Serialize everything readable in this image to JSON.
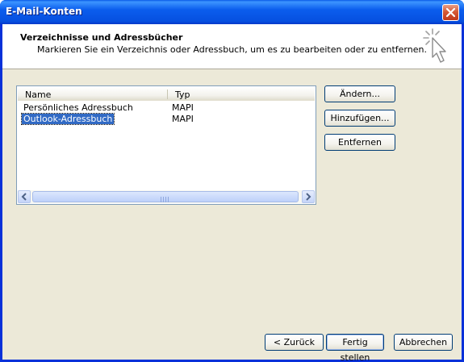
{
  "window": {
    "title": "E-Mail-Konten"
  },
  "header": {
    "title": "Verzeichnisse und Adressbücher",
    "subtitle": "Markieren Sie ein Verzeichnis oder Adressbuch, um es zu bearbeiten oder zu entfernen."
  },
  "list": {
    "columns": {
      "name": "Name",
      "type": "Typ"
    },
    "rows": [
      {
        "name": "Persönliches Adressbuch",
        "type": "MAPI",
        "selected": false
      },
      {
        "name": "Outlook-Adressbuch",
        "type": "MAPI",
        "selected": true
      }
    ]
  },
  "side_buttons": {
    "change": "Ändern...",
    "add": "Hinzufügen...",
    "remove": "Entfernen"
  },
  "footer_buttons": {
    "back": "< Zurück",
    "finish": "Fertig stellen",
    "cancel": "Abbrechen"
  },
  "colors": {
    "titlebar": "#0b5ded",
    "face": "#ece9d8",
    "selection": "#316ac5",
    "close": "#d65a36"
  },
  "icons": [
    "close-icon",
    "wizard-cursor-icon",
    "scroll-left-icon",
    "scroll-right-icon"
  ]
}
